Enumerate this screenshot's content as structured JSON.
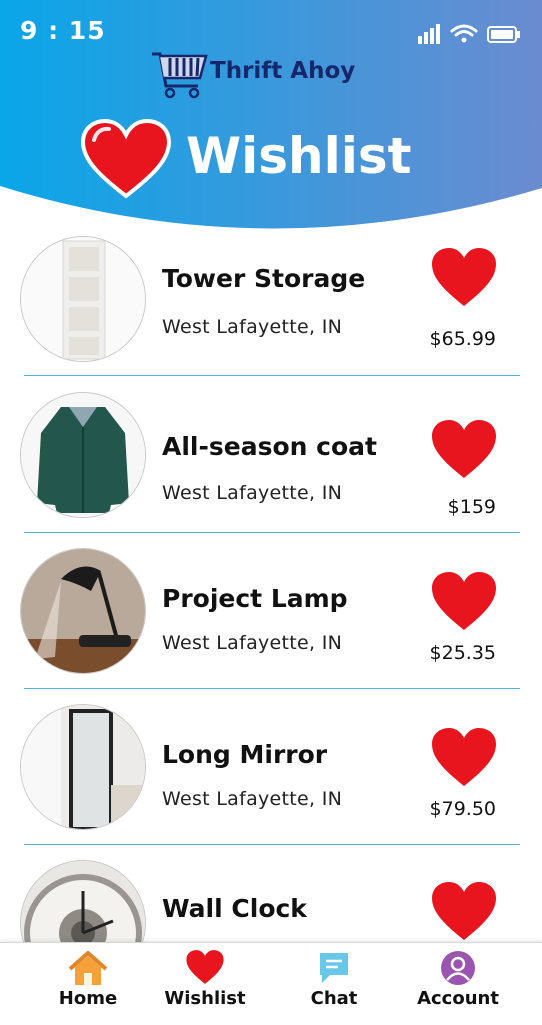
{
  "status_bar": {
    "time": "9 : 15"
  },
  "header": {
    "brand": "Thrift Ahoy",
    "title": "Wishlist",
    "gradient_start": "#09a6e8",
    "gradient_end": "#6b8bd0"
  },
  "items": [
    {
      "name": "Tower Storage",
      "location": "West Lafayette, IN",
      "price": "$65.99",
      "image": "storage-tower-photo"
    },
    {
      "name": "All-season coat",
      "location": "West Lafayette, IN",
      "price": "$159",
      "image": "green-coat-photo"
    },
    {
      "name": "Project Lamp",
      "location": "West Lafayette, IN",
      "price": "$25.35",
      "image": "desk-lamp-photo"
    },
    {
      "name": "Long Mirror",
      "location": "West Lafayette, IN",
      "price": "$79.50",
      "image": "floor-mirror-photo"
    },
    {
      "name": "Wall Clock",
      "location": "",
      "price": "",
      "image": "wall-clock-photo"
    }
  ],
  "tabbar": {
    "home": "Home",
    "wishlist": "Wishlist",
    "chat": "Chat",
    "account": "Account"
  },
  "colors": {
    "heart": "#e8151f",
    "divider": "#4fb4e0",
    "home_icon": "#f6a03a",
    "chat_icon": "#69c8e8",
    "account_icon": "#9b55b0"
  }
}
